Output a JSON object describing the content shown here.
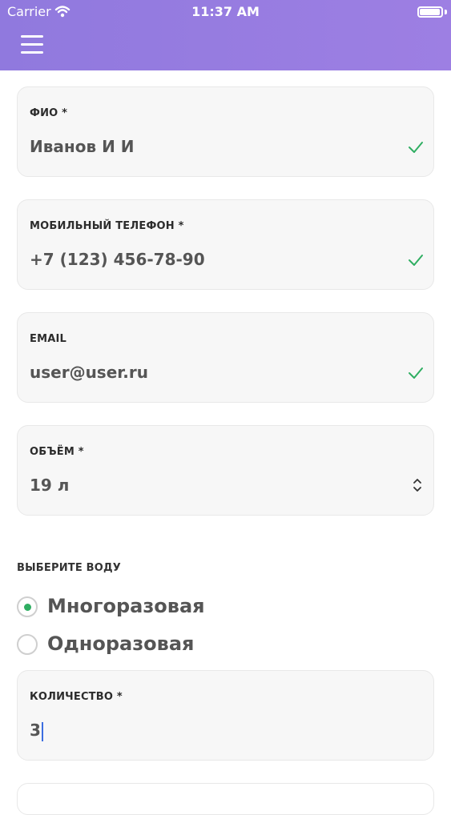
{
  "status_bar": {
    "carrier": "Carrier",
    "time": "11:37 AM"
  },
  "header": {
    "menu_icon": "hamburger-menu-icon",
    "background_color": "#9079de"
  },
  "form": {
    "fields": [
      {
        "label": "ФИО *",
        "value": "Иванов И И",
        "status_icon": "check-icon"
      },
      {
        "label": "МОБИЛЬНЫЙ ТЕЛЕФОН *",
        "value": "+7 (123) 456-78-90",
        "status_icon": "check-icon"
      },
      {
        "label": "EMAIL",
        "value": "user@user.ru",
        "status_icon": "check-icon"
      },
      {
        "label": "ОБЪЁМ *",
        "value": "19 л",
        "status_icon": "chevron-updown-icon"
      }
    ],
    "water_section": {
      "label": "ВЫБЕРИТЕ ВОДУ",
      "options": [
        {
          "label": "Многоразовая",
          "selected": true
        },
        {
          "label": "Одноразовая",
          "selected": false
        }
      ]
    },
    "quantity": {
      "label": "КОЛИЧЕСТВО *",
      "value": "3"
    }
  },
  "colors": {
    "accent": "#9079de",
    "success": "#2fae62",
    "card": "#f7f7f7"
  }
}
